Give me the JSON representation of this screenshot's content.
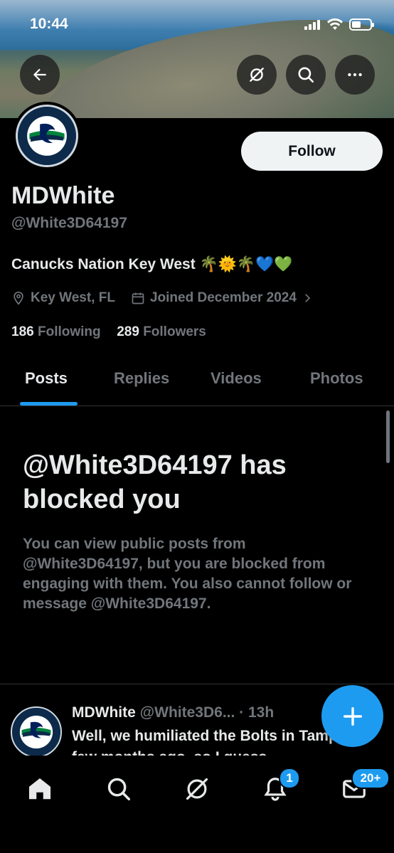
{
  "status_bar": {
    "time": "10:44"
  },
  "profile": {
    "follow_label": "Follow",
    "name": "MDWhite",
    "handle": "@White3D64197",
    "bio": "Canucks Nation Key West 🌴🌞🌴💙💚",
    "location": "Key West, FL",
    "joined": "Joined December 2024",
    "following_count": "186",
    "following_label": "Following",
    "followers_count": "289",
    "followers_label": "Followers"
  },
  "tabs": [
    {
      "label": "Posts",
      "active": true
    },
    {
      "label": "Replies",
      "active": false
    },
    {
      "label": "Videos",
      "active": false
    },
    {
      "label": "Photos",
      "active": false
    }
  ],
  "blocked": {
    "title": "@White3D64197 has blocked you",
    "description": "You can view public posts from @White3D64197, but you are blocked from engaging with them. You also cannot follow or message @White3D64197."
  },
  "post": {
    "author": "MDWhite",
    "handle_time": "@White3D6... · 13h",
    "text": "Well, we humiliated the Bolts in Tampa a few months ago, so I guess"
  },
  "nav": {
    "notifications_badge": "1",
    "messages_badge": "20+"
  },
  "colors": {
    "accent": "#1d9bf0",
    "muted_text": "#71767b",
    "primary_text": "#e7e9ea",
    "background": "#000000"
  },
  "icons": {
    "back": "arrow-left-icon",
    "grok": "grok-icon",
    "search": "search-icon",
    "more": "more-icon",
    "location": "location-pin-icon",
    "calendar": "calendar-icon",
    "chevron": "chevron-right-icon",
    "compose": "plus-icon",
    "home": "home-icon",
    "explore": "search-icon",
    "grok_nav": "grok-icon",
    "notifications": "bell-icon",
    "messages": "envelope-icon"
  }
}
